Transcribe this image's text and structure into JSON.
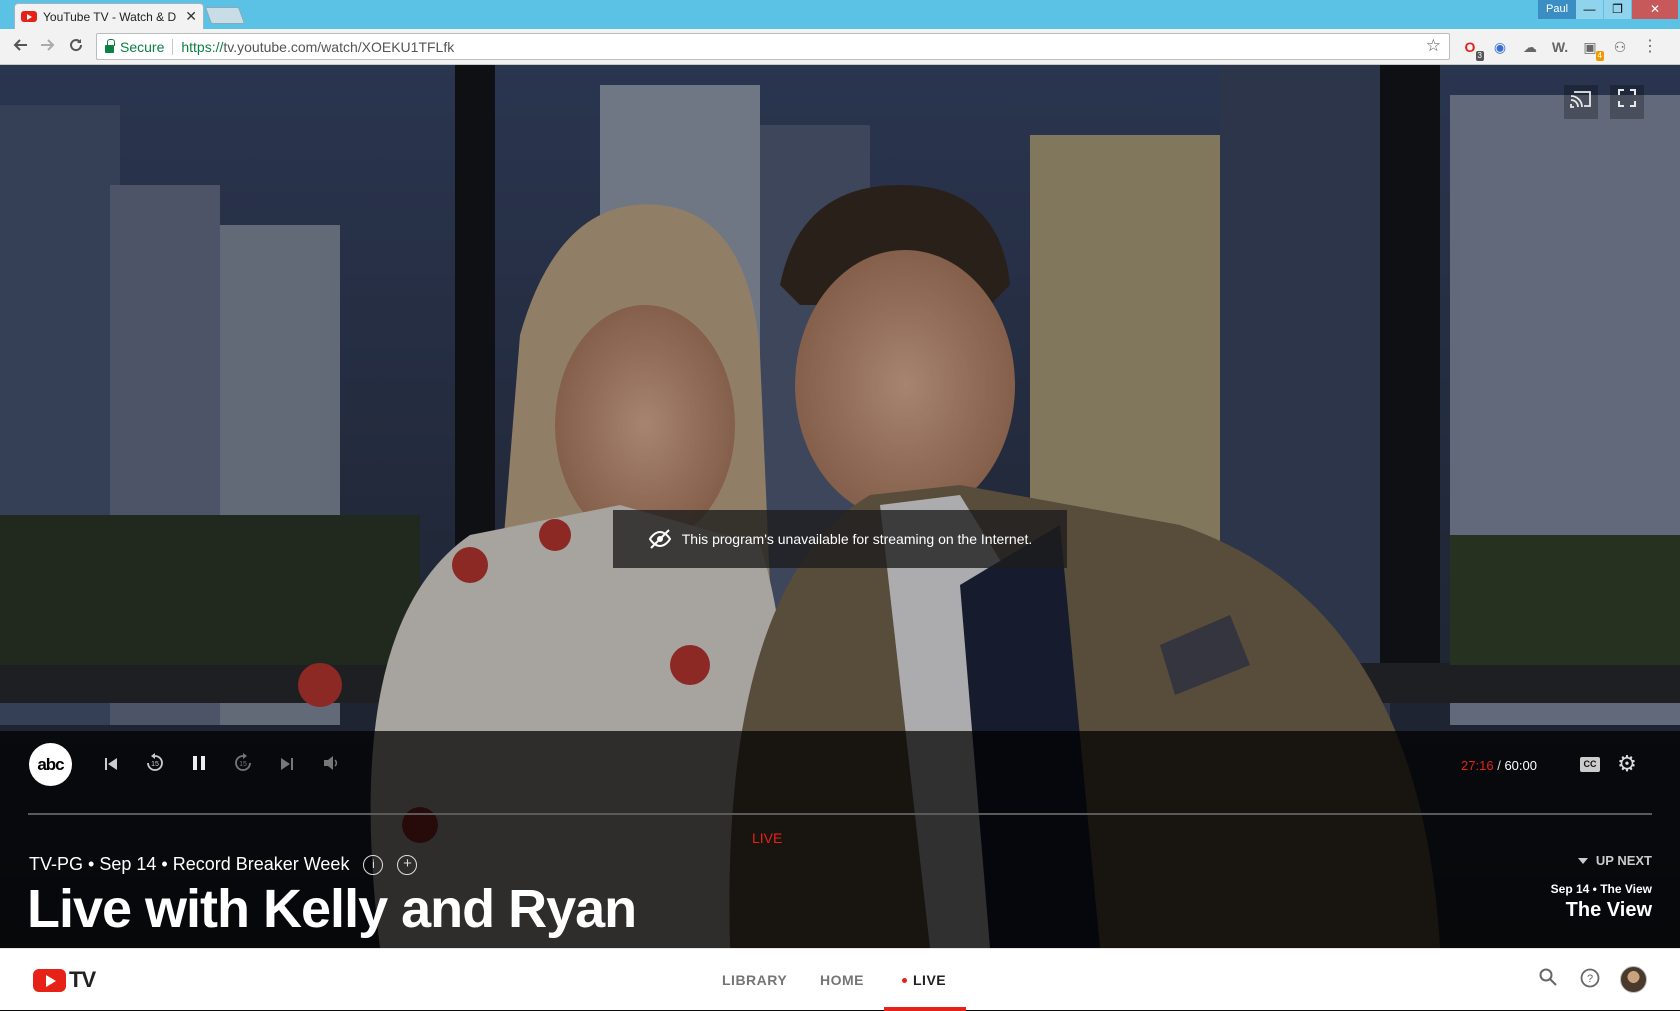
{
  "browser": {
    "tab_title": "YouTube TV - Watch & D",
    "tab_close": "✕",
    "user_name": "Paul",
    "window_min": "—",
    "window_max": "❐",
    "window_close": "✕",
    "secure_label": "Secure",
    "url_scheme": "https://",
    "url_rest": "tv.youtube.com/watch/XOEKU1TFLfk",
    "extensions": [
      {
        "icon": "opera-icon",
        "badge": "3"
      },
      {
        "icon": "ext-icon-2",
        "badge": ""
      },
      {
        "icon": "cloud-icon",
        "badge": ""
      },
      {
        "icon": "word-icon",
        "label": "W.",
        "badge": ""
      },
      {
        "icon": "ext-icon-5",
        "badge": "4"
      },
      {
        "icon": "network-icon",
        "badge": ""
      }
    ]
  },
  "player": {
    "message": "This program's unavailable for streaming on the Internet.",
    "network_logo": "abc",
    "time_current": "27:16",
    "time_separator": "/",
    "time_total": "60:00",
    "cc_label": "CC",
    "live_label": "LIVE",
    "meta_rating": "TV-PG",
    "meta_date": "Sep 14",
    "meta_episode": "Record Breaker Week",
    "meta_sep": "•",
    "show_title": "Live with Kelly and Ryan",
    "up_next": {
      "label": "UP NEXT",
      "date_line": "Sep 14 • The View",
      "title": "The View"
    }
  },
  "bottom_nav": {
    "logo_text": "TV",
    "items": [
      {
        "label": "LIBRARY"
      },
      {
        "label": "HOME"
      },
      {
        "label": "LIVE"
      }
    ],
    "active": "LIVE"
  },
  "colors": {
    "accent_red": "#e62117",
    "chrome_blue": "#5bc2e6",
    "secure_green": "#0b8043"
  }
}
